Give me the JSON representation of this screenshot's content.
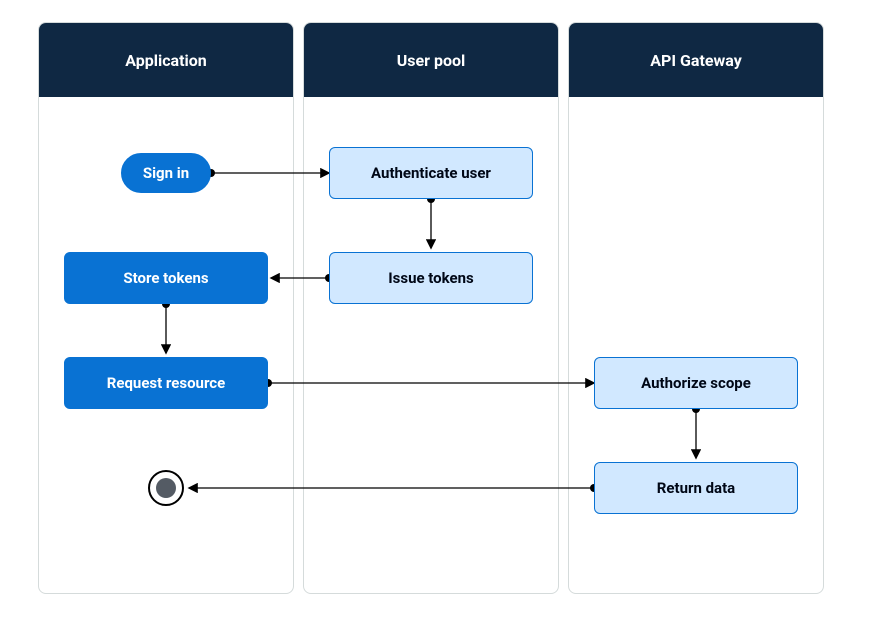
{
  "lanes": {
    "application": "Application",
    "userpool": "User pool",
    "apigateway": "API Gateway"
  },
  "nodes": {
    "signin": "Sign in",
    "store_tokens": "Store tokens",
    "request_resource": "Request resource",
    "authenticate_user": "Authenticate user",
    "issue_tokens": "Issue tokens",
    "authorize_scope": "Authorize scope",
    "return_data": "Return data"
  }
}
